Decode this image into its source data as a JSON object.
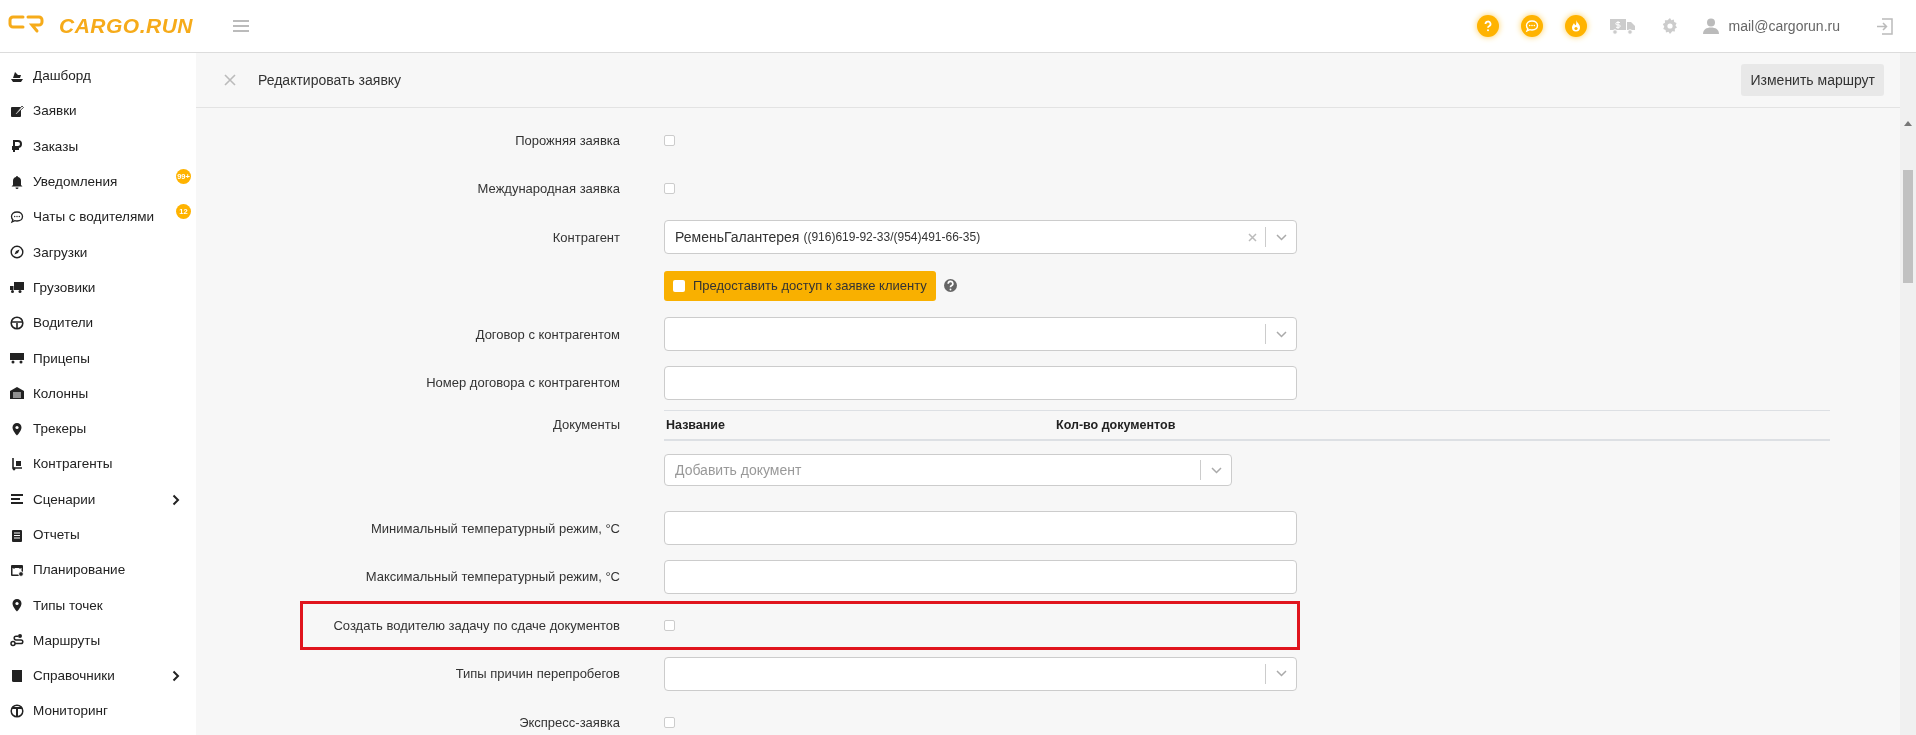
{
  "header": {
    "logo": "CARGO.RUN",
    "user_email": "mail@cargorun.ru"
  },
  "sidebar": {
    "items": [
      {
        "label": "Дашборд",
        "has_submenu": false
      },
      {
        "label": "Заявки",
        "has_submenu": false
      },
      {
        "label": "Заказы",
        "has_submenu": false
      },
      {
        "label": "Уведомления",
        "badge": "99+",
        "has_submenu": false
      },
      {
        "label": "Чаты с водителями",
        "badge": "12",
        "has_submenu": false
      },
      {
        "label": "Загрузки",
        "has_submenu": false
      },
      {
        "label": "Грузовики",
        "has_submenu": false
      },
      {
        "label": "Водители",
        "has_submenu": false
      },
      {
        "label": "Прицепы",
        "has_submenu": false
      },
      {
        "label": "Колонны",
        "has_submenu": false
      },
      {
        "label": "Трекеры",
        "has_submenu": false
      },
      {
        "label": "Контрагенты",
        "has_submenu": false
      },
      {
        "label": "Сценарии",
        "has_submenu": true
      },
      {
        "label": "Отчеты",
        "has_submenu": false
      },
      {
        "label": "Планирование",
        "has_submenu": false
      },
      {
        "label": "Типы точек",
        "has_submenu": false
      },
      {
        "label": "Маршруты",
        "has_submenu": false
      },
      {
        "label": "Справочники",
        "has_submenu": true
      },
      {
        "label": "Мониторинг",
        "has_submenu": false
      }
    ]
  },
  "panel": {
    "title": "Редактировать заявку",
    "action_button": "Изменить маршрут",
    "rows": [
      {
        "kind": "checkbox",
        "label": "Порожняя заявка",
        "checked": false,
        "highlighted": false
      },
      {
        "kind": "checkbox",
        "label": "Международная заявка",
        "checked": false,
        "highlighted": false
      },
      {
        "kind": "select",
        "label": "Контрагент",
        "value": "РеменьГалантерея",
        "value_detail": "((916)619-92-33/(954)491-66-35)",
        "clearable": true,
        "highlighted": false
      },
      {
        "kind": "access-toggle",
        "button_label": "Предоставить доступ к заявке клиенту",
        "checked": false,
        "highlighted": false
      },
      {
        "kind": "select",
        "label": "Договор с контрагентом",
        "clearable": false,
        "highlighted": false
      },
      {
        "kind": "text",
        "label": "Номер договора с контрагентом",
        "highlighted": false
      },
      {
        "kind": "documents",
        "label": "Документы",
        "columns": [
          "Название",
          "Кол-во документов"
        ],
        "add_placeholder": "Добавить документ",
        "highlighted": false
      },
      {
        "kind": "text",
        "label": "Минимальный температурный режим, °C",
        "highlighted": false
      },
      {
        "kind": "text",
        "label": "Максимальный температурный режим, °C",
        "highlighted": false
      },
      {
        "kind": "checkbox",
        "label": "Создать водителю задачу по сдаче документов",
        "checked": false,
        "highlighted": true
      },
      {
        "kind": "select",
        "label": "Типы причин перепробегов",
        "clearable": false,
        "highlighted": false
      },
      {
        "kind": "checkbox",
        "label": "Экспресс-заявка",
        "checked": false,
        "highlighted": false
      }
    ]
  }
}
